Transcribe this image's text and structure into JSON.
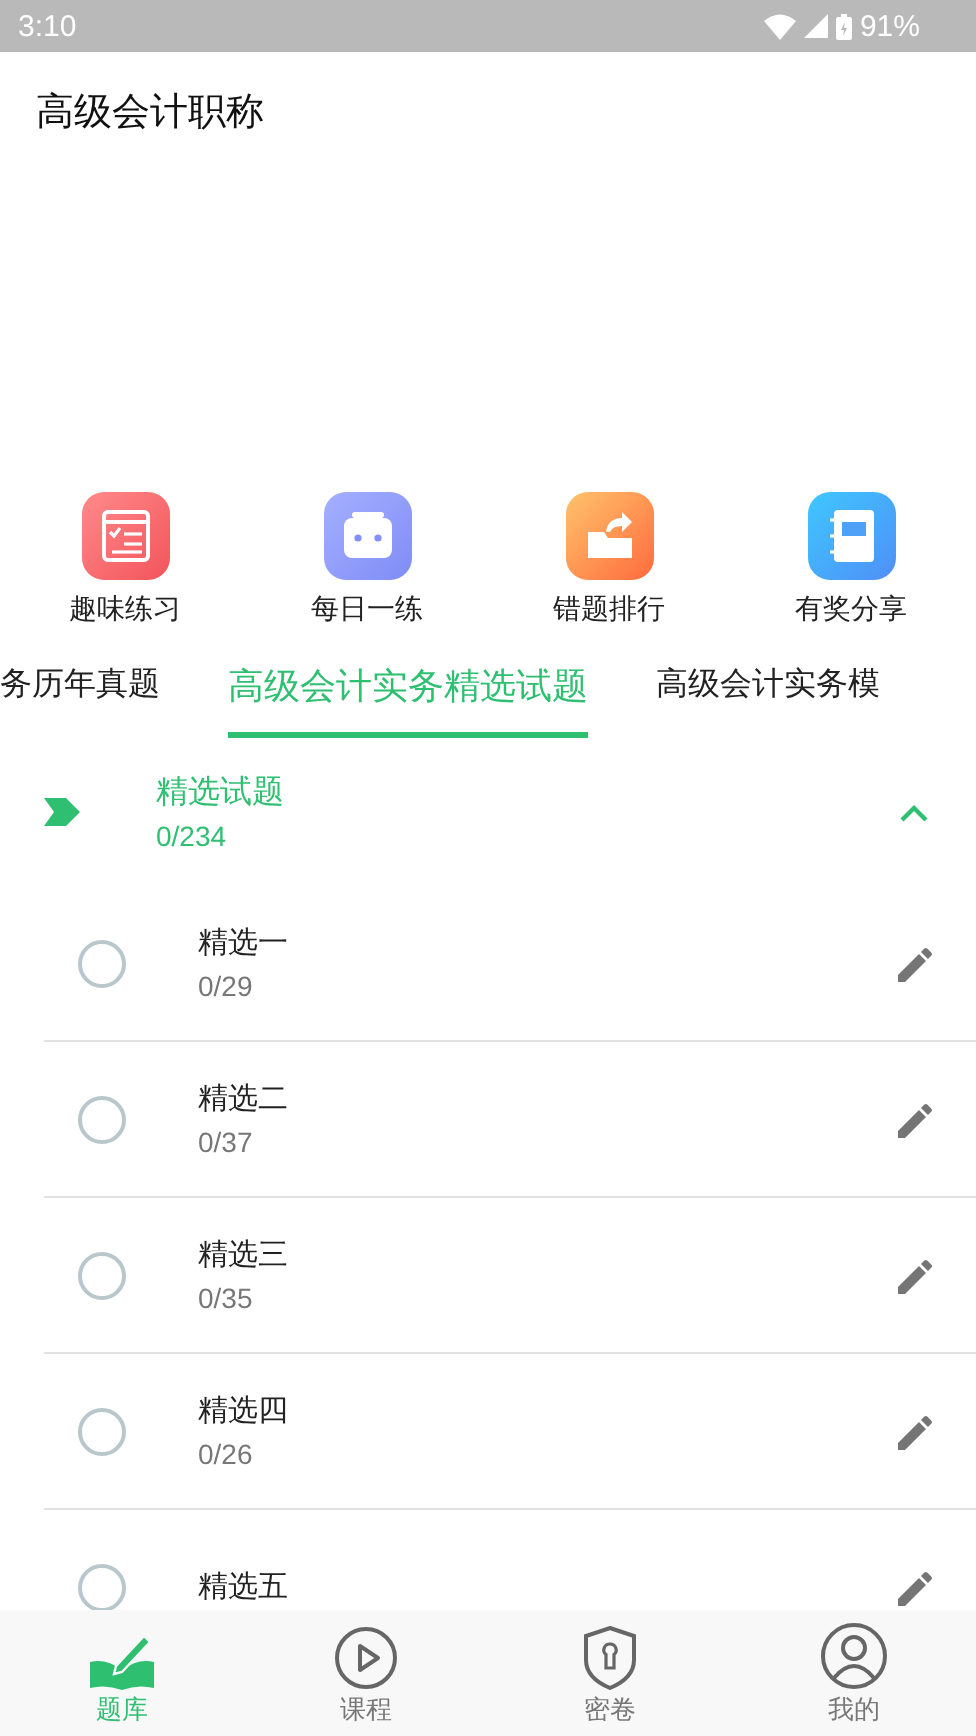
{
  "status_bar": {
    "time": "3:10",
    "battery": "91%"
  },
  "title": "高级会计职称",
  "shortcuts": [
    {
      "label": "趣味练习",
      "kind": "checklist"
    },
    {
      "label": "每日一练",
      "kind": "robot"
    },
    {
      "label": "错题排行",
      "kind": "folder"
    },
    {
      "label": "有奖分享",
      "kind": "notebook"
    }
  ],
  "tabs": [
    {
      "label": "务历年真题",
      "selected": false
    },
    {
      "label": "高级会计实务精选试题",
      "selected": true
    },
    {
      "label": "高级会计实务模",
      "selected": false
    }
  ],
  "section": {
    "title": "精选试题",
    "count": "0/234",
    "expanded": true
  },
  "items": [
    {
      "title": "精选一",
      "count": "0/29",
      "checked": false
    },
    {
      "title": "精选二",
      "count": "0/37",
      "checked": false
    },
    {
      "title": "精选三",
      "count": "0/35",
      "checked": false
    },
    {
      "title": "精选四",
      "count": "0/26",
      "checked": false
    },
    {
      "title": "精选五",
      "checked": false
    }
  ],
  "nav": [
    {
      "label": "题库",
      "kind": "book",
      "selected": true
    },
    {
      "label": "课程",
      "kind": "play",
      "selected": false
    },
    {
      "label": "密卷",
      "kind": "shield",
      "selected": false
    },
    {
      "label": "我的",
      "kind": "user",
      "selected": false
    }
  ]
}
